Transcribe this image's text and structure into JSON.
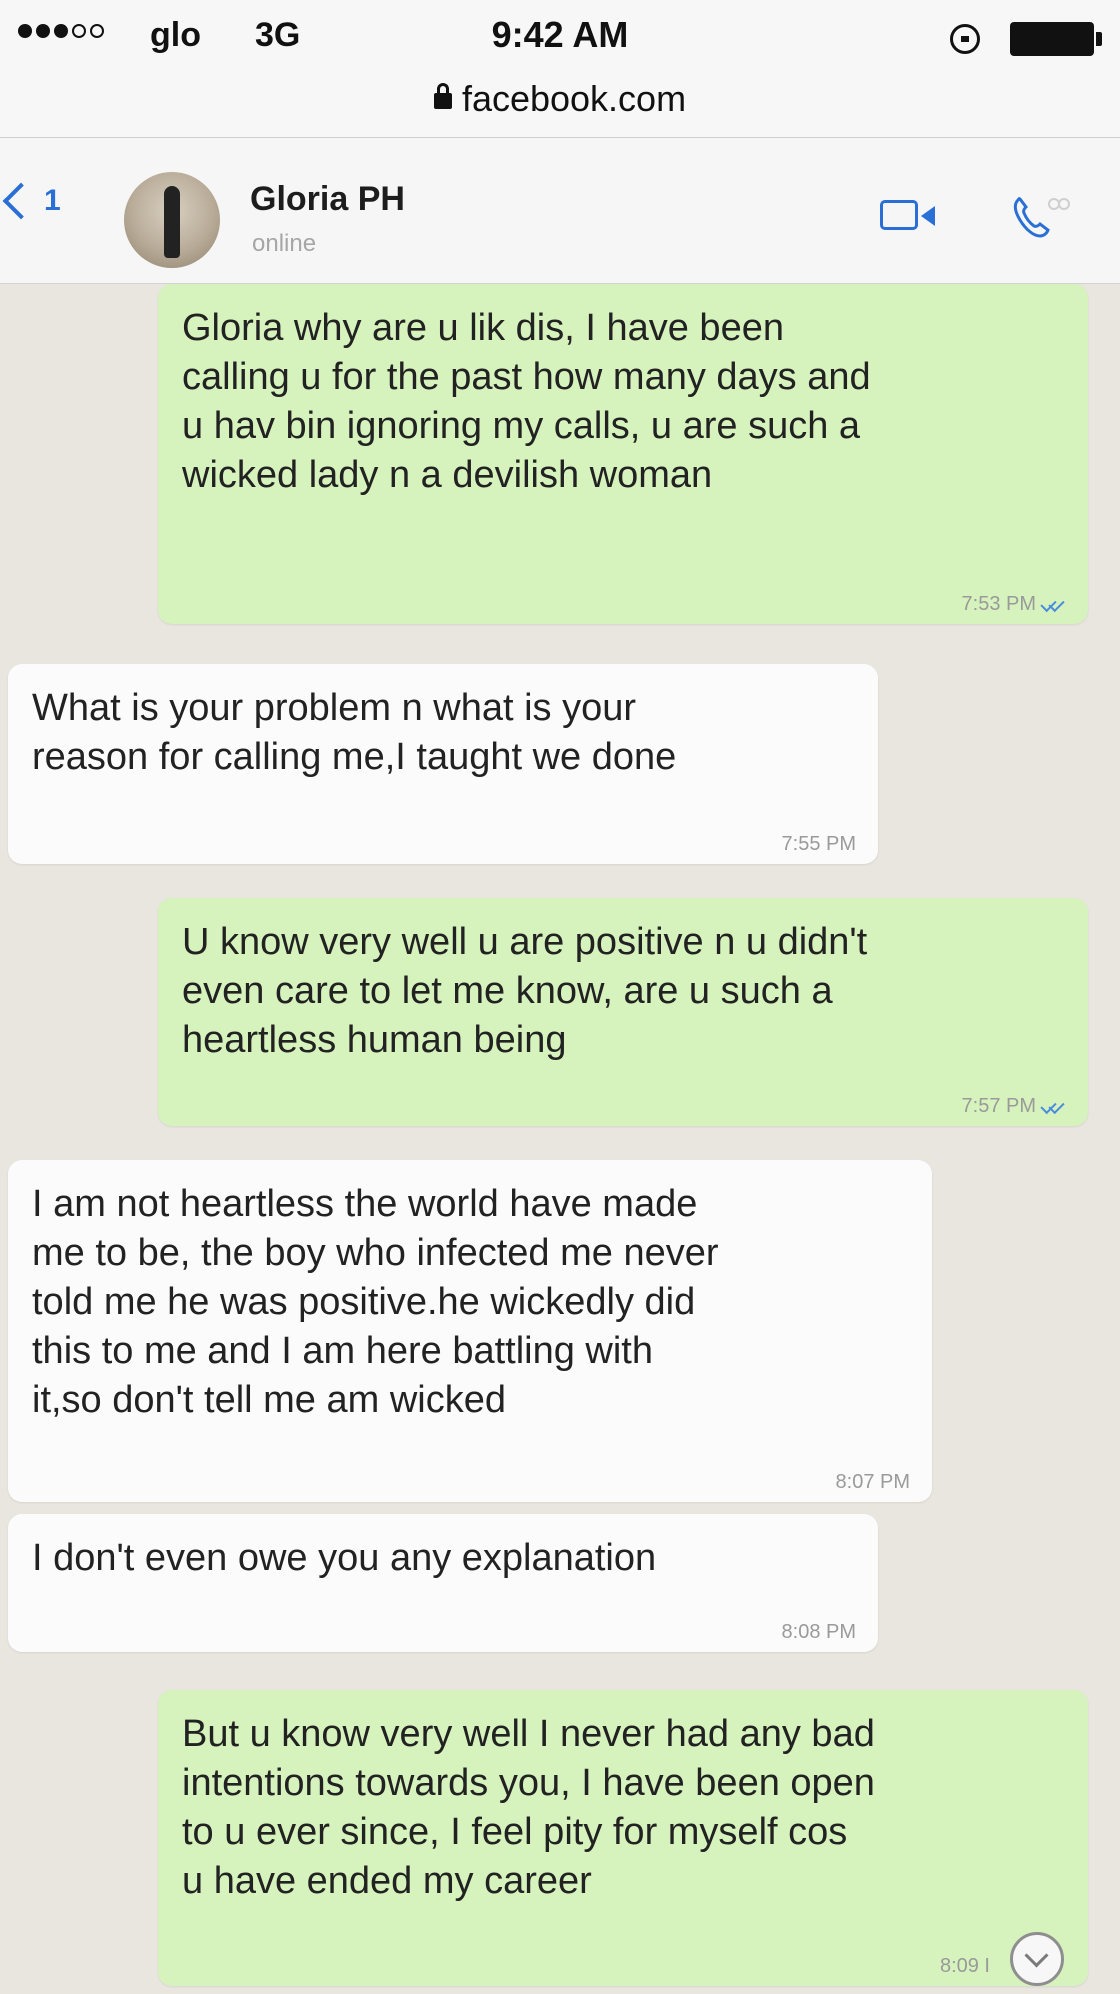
{
  "status_bar": {
    "signal_dots_filled": 3,
    "signal_dots_empty": 2,
    "carrier": "glo",
    "network": "3G",
    "time": "9:42 AM",
    "icons": [
      "signal-dots-icon",
      "rotation-lock-icon",
      "battery-icon"
    ]
  },
  "url_bar": {
    "lock_icon": "lock-icon",
    "url": "facebook.com"
  },
  "chat_header": {
    "back_count": "1",
    "contact_name": "Gloria PH",
    "contact_status": "online",
    "icons": [
      "chevron-left-icon",
      "avatar",
      "video-call-icon",
      "voice-call-icon"
    ]
  },
  "messages": [
    {
      "direction": "outgoing",
      "text": "Gloria why are u lik dis, I have been\ncalling u for the past how many days and\nu hav bin ignoring my calls, u are such a\nwicked lady n a devilish woman",
      "time": "7:53 PM",
      "read": true
    },
    {
      "direction": "incoming",
      "text": "What is your problem n what is your\nreason for calling me,I taught we done",
      "time": "7:55 PM"
    },
    {
      "direction": "outgoing",
      "text": "U know very well u are positive n u didn't\neven care to let me know, are u such a\nheartless human being",
      "time": "7:57 PM",
      "read": true
    },
    {
      "direction": "incoming",
      "text": "I am not heartless the world have made\nme to be, the boy who infected me never\ntold me he was positive.he wickedly did\nthis to me and I am here battling with\nit,so don't tell me am wicked",
      "time": "8:07 PM"
    },
    {
      "direction": "incoming",
      "text": "I don't even owe you any explanation",
      "time": "8:08 PM"
    },
    {
      "direction": "outgoing",
      "text": "But u know very well I never had any bad\nintentions towards you, I have been open\nto u ever since, I feel pity for myself cos\nu have ended my career",
      "time": "8:09 I",
      "read": false
    }
  ],
  "scroll_button": "chevron-down-icon",
  "colors": {
    "outgoing_bubble": "#d6f2bd",
    "incoming_bubble": "#fbfbfb",
    "chat_background": "#e9e6df",
    "accent_blue": "#2a6fd6",
    "read_tick": "#4a8be0"
  }
}
